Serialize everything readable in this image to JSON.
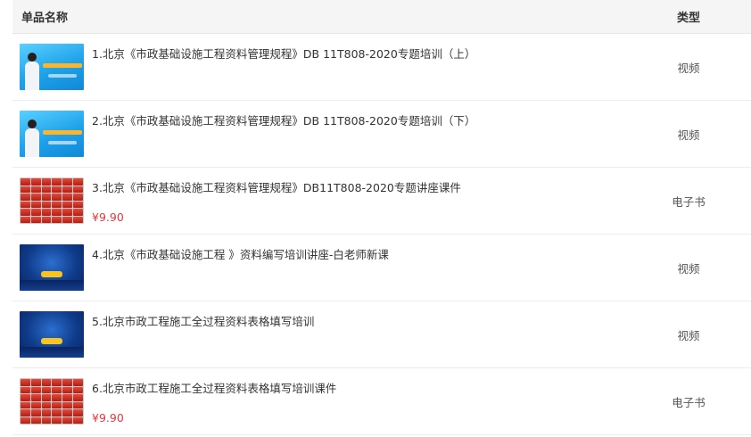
{
  "header": {
    "name_col": "单品名称",
    "type_col": "类型"
  },
  "items": [
    {
      "title": "1.北京《市政基础设施工程资料管理规程》DB 11T808-2020专题培训（上）",
      "price": "",
      "type": "视频"
    },
    {
      "title": "2.北京《市政基础设施工程资料管理规程》DB 11T808-2020专题培训（下）",
      "price": "",
      "type": "视频"
    },
    {
      "title": "3.北京《市政基础设施工程资料管理规程》DB11T808-2020专题讲座课件",
      "price": "¥9.90",
      "type": "电子书"
    },
    {
      "title": "4.北京《市政基础设施工程 》资料编写培训讲座-白老师新课",
      "price": "",
      "type": "视频"
    },
    {
      "title": "5.北京市政工程施工全过程资料表格填写培训",
      "price": "",
      "type": "视频"
    },
    {
      "title": "6.北京市政工程施工全过程资料表格填写培训课件",
      "price": "¥9.90",
      "type": "电子书"
    }
  ],
  "colors": {
    "price": "#e4393c",
    "header_bg": "#f5f5f5",
    "divider": "#ececec"
  }
}
